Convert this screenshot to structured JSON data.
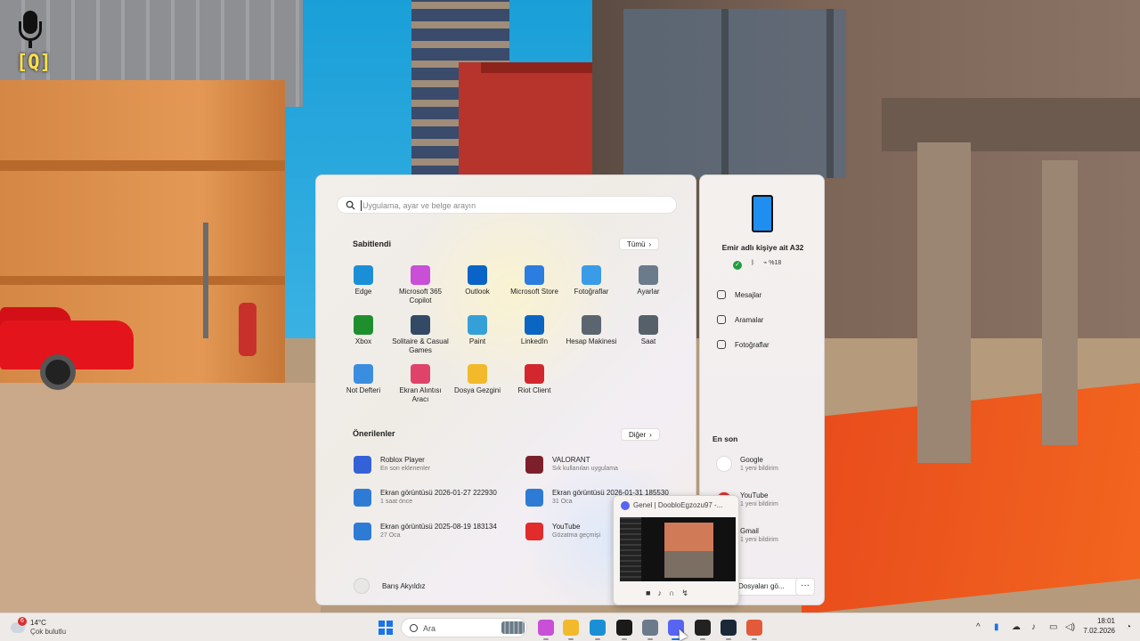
{
  "overlay": {
    "push_to_talk_key": "[Q]"
  },
  "search": {
    "placeholder": "Uygulama, ayar ve belge arayın"
  },
  "pinned": {
    "title": "Sabitlendi",
    "all_button": "Tümü",
    "apps": [
      {
        "label": "Edge",
        "icon": "edge-icon",
        "color": "#1b8fd6"
      },
      {
        "label": "Microsoft 365 Copilot",
        "icon": "copilot-icon",
        "color": "#c94fd6"
      },
      {
        "label": "Outlook",
        "icon": "outlook-icon",
        "color": "#0a64c8"
      },
      {
        "label": "Microsoft Store",
        "icon": "store-icon",
        "color": "#2b7de0"
      },
      {
        "label": "Fotoğraflar",
        "icon": "photos-icon",
        "color": "#3a9be8"
      },
      {
        "label": "Ayarlar",
        "icon": "gear-icon",
        "color": "#6b7b8c"
      },
      {
        "label": "Xbox",
        "icon": "xbox-icon",
        "color": "#1f8f2e"
      },
      {
        "label": "Solitaire & Casual Games",
        "icon": "solitaire-icon",
        "color": "#334a66"
      },
      {
        "label": "Paint",
        "icon": "paint-icon",
        "color": "#35a0d8"
      },
      {
        "label": "LinkedIn",
        "icon": "linkedin-icon",
        "color": "#0a66c2"
      },
      {
        "label": "Hesap Makinesi",
        "icon": "calculator-icon",
        "color": "#5b6570"
      },
      {
        "label": "Saat",
        "icon": "clock-icon",
        "color": "#55606a"
      },
      {
        "label": "Not Defteri",
        "icon": "notepad-icon",
        "color": "#3b8de0"
      },
      {
        "label": "Ekran Alıntısı Aracı",
        "icon": "snipping-icon",
        "color": "#e0436a"
      },
      {
        "label": "Dosya Gezgini",
        "icon": "folder-icon",
        "color": "#f2b92b"
      },
      {
        "label": "Riot Client",
        "icon": "riot-icon",
        "color": "#d3262e"
      }
    ]
  },
  "recommended": {
    "title": "Önerilenler",
    "more_button": "Diğer",
    "items": [
      {
        "title": "Roblox Player",
        "subtitle": "En son eklenenler",
        "icon": "roblox-icon",
        "color": "#3561d8"
      },
      {
        "title": "VALORANT",
        "subtitle": "Sık kullanılan uygulama",
        "icon": "valorant-icon",
        "color": "#7d1f2a"
      },
      {
        "title": "Ekran görüntüsü 2026-01-27 222930",
        "subtitle": "1 saat önce",
        "icon": "image-file-icon",
        "color": "#2e7bd6"
      },
      {
        "title": "Ekran görüntüsü 2026-01-31 185530",
        "subtitle": "31 Oca",
        "icon": "image-file-icon",
        "color": "#2e7bd6"
      },
      {
        "title": "Ekran görüntüsü 2025-08-19 183134",
        "subtitle": "27 Oca",
        "icon": "image-file-icon",
        "color": "#2e7bd6"
      },
      {
        "title": "YouTube",
        "subtitle": "Gözatma geçmişi",
        "icon": "youtube-icon",
        "color": "#e22b2b"
      }
    ]
  },
  "user": {
    "name": "Barış Akyıldız"
  },
  "phone": {
    "title": "Emir adlı kişiye ait A32",
    "battery": "%18",
    "links": [
      "Mesajlar",
      "Aramalar",
      "Fotoğraflar"
    ],
    "recent_title": "En son",
    "notifications": [
      {
        "app": "Google",
        "detail": "1 yeni bildirim",
        "icon": "google-icon",
        "color": "#ffffff"
      },
      {
        "app": "YouTube",
        "detail": "1 yeni bildirim",
        "icon": "youtube-icon",
        "color": "#e22b2b"
      },
      {
        "app": "Gmail",
        "detail": "1 yeni bildirim",
        "icon": "gmail-icon",
        "color": "#ffffff"
      }
    ],
    "files_button": "Dosyaları gö...",
    "more_button": "···"
  },
  "discord_preview": {
    "title": "Genel | DoobloEgzozu97 -..."
  },
  "taskbar": {
    "weather_temp": "14°C",
    "weather_condition": "Çok bulutlu",
    "weather_badge": "6",
    "search_label": "Ara",
    "apps": [
      {
        "name": "copilot",
        "color": "#c94fd6"
      },
      {
        "name": "file-explorer",
        "color": "#f2b92b"
      },
      {
        "name": "edge",
        "color": "#1b8fd6"
      },
      {
        "name": "epic-launcher-dark",
        "color": "#1a1a1a"
      },
      {
        "name": "settings",
        "color": "#6b7b8c"
      },
      {
        "name": "discord",
        "color": "#5865f2"
      },
      {
        "name": "epic-games",
        "color": "#222222"
      },
      {
        "name": "steam",
        "color": "#1b2838"
      },
      {
        "name": "roblox-studio",
        "color": "#e25a3a"
      }
    ],
    "time": "18:01",
    "date": "7.02.2026"
  }
}
